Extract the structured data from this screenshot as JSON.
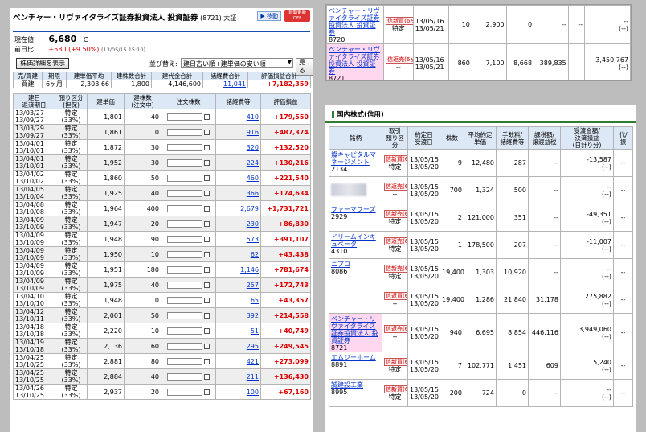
{
  "left": {
    "title": "ベンチャー・リヴァイタライズ証券投資法人 投資証券",
    "code": "(8721)",
    "market": "大証",
    "btn_move": "移動",
    "btn_auto": "自動更新 OFF",
    "price_label": "現在値",
    "price": "6,680",
    "price_mark": "C",
    "change_label": "前日比",
    "change": "+580 (+9.50%)",
    "change_time": "(13/05/15 15:10)",
    "btn_detail": "株価詳細を表示",
    "sort_label": "並び替え:",
    "sort_value": "建日古い順+建単価の安い順",
    "btn_view": "見る",
    "sum_headers": [
      "売/買建",
      "期限",
      "建単価平均",
      "建株数合計",
      "建代金合計",
      "諸経費合計",
      "評価損益合計"
    ],
    "sum_row": [
      "買建",
      "6ヶ月",
      "2,303.66",
      "1,800",
      "4,146,600",
      "11,041",
      "+7,182,359"
    ],
    "headers": [
      "建日\n返済期日",
      "預り区分\n(担保)",
      "建単価",
      "建株数\n(注文中)",
      "注文株数",
      "諸経費等",
      "評価損益"
    ],
    "rows": [
      {
        "date": "13/03/27",
        "due": "13/09/27",
        "kb": "特定",
        "tan": "(33%)",
        "price": "1,801",
        "qty": "40",
        "fee": "410",
        "pl": "+179,550"
      },
      {
        "date": "13/03/29",
        "due": "13/09/27",
        "kb": "特定",
        "tan": "(33%)",
        "price": "1,861",
        "qty": "110",
        "fee": "916",
        "pl": "+487,374"
      },
      {
        "date": "13/04/01",
        "due": "13/10/01",
        "kb": "特定",
        "tan": "(33%)",
        "price": "1,872",
        "qty": "30",
        "fee": "320",
        "pl": "+132,520"
      },
      {
        "date": "13/04/01",
        "due": "13/10/01",
        "kb": "特定",
        "tan": "(33%)",
        "price": "1,952",
        "qty": "30",
        "fee": "224",
        "pl": "+130,216"
      },
      {
        "date": "13/04/02",
        "due": "13/10/02",
        "kb": "特定",
        "tan": "(33%)",
        "price": "1,860",
        "qty": "50",
        "fee": "460",
        "pl": "+221,540"
      },
      {
        "date": "13/04/05",
        "due": "13/10/04",
        "kb": "特定",
        "tan": "(33%)",
        "price": "1,925",
        "qty": "40",
        "fee": "366",
        "pl": "+174,634"
      },
      {
        "date": "13/04/08",
        "due": "13/10/08",
        "kb": "特定",
        "tan": "(33%)",
        "price": "1,964",
        "qty": "400",
        "fee": "2,679",
        "pl": "+1,731,721"
      },
      {
        "date": "13/04/09",
        "due": "13/10/09",
        "kb": "特定",
        "tan": "(33%)",
        "price": "1,947",
        "qty": "20",
        "fee": "230",
        "pl": "+86,830"
      },
      {
        "date": "13/04/09",
        "due": "13/10/09",
        "kb": "特定",
        "tan": "(33%)",
        "price": "1,948",
        "qty": "90",
        "fee": "573",
        "pl": "+391,107"
      },
      {
        "date": "13/04/09",
        "due": "13/10/09",
        "kb": "特定",
        "tan": "(33%)",
        "price": "1,950",
        "qty": "10",
        "fee": "62",
        "pl": "+43,438"
      },
      {
        "date": "13/04/09",
        "due": "13/10/09",
        "kb": "特定",
        "tan": "(33%)",
        "price": "1,951",
        "qty": "180",
        "fee": "1,146",
        "pl": "+781,674"
      },
      {
        "date": "13/04/09",
        "due": "13/10/09",
        "kb": "特定",
        "tan": "(33%)",
        "price": "1,975",
        "qty": "40",
        "fee": "257",
        "pl": "+172,743"
      },
      {
        "date": "13/04/10",
        "due": "13/10/10",
        "kb": "特定",
        "tan": "(33%)",
        "price": "1,948",
        "qty": "10",
        "fee": "65",
        "pl": "+43,357"
      },
      {
        "date": "13/04/12",
        "due": "13/10/11",
        "kb": "特定",
        "tan": "(33%)",
        "price": "2,001",
        "qty": "50",
        "fee": "392",
        "pl": "+214,558"
      },
      {
        "date": "13/04/18",
        "due": "13/10/18",
        "kb": "特定",
        "tan": "(33%)",
        "price": "2,220",
        "qty": "10",
        "fee": "51",
        "pl": "+40,749"
      },
      {
        "date": "13/04/19",
        "due": "13/10/18",
        "kb": "特定",
        "tan": "(33%)",
        "price": "2,136",
        "qty": "60",
        "fee": "295",
        "pl": "+249,545"
      },
      {
        "date": "13/04/25",
        "due": "13/10/25",
        "kb": "特定",
        "tan": "(33%)",
        "price": "2,881",
        "qty": "80",
        "fee": "421",
        "pl": "+273,099"
      },
      {
        "date": "13/04/25",
        "due": "13/10/25",
        "kb": "特定",
        "tan": "(33%)",
        "price": "2,884",
        "qty": "40",
        "fee": "211",
        "pl": "+136,430"
      },
      {
        "date": "13/04/26",
        "due": "13/10/25",
        "kb": "特定",
        "tan": "(33%)",
        "price": "2,937",
        "qty": "20",
        "fee": "100",
        "pl": "+67,160"
      }
    ]
  },
  "topright": {
    "rows": [
      {
        "name": "ベンチャー・リヴァイタライズ証券投資法人 投資証券",
        "code": "8720",
        "badge": "信新買(6ヶ月)",
        "kb": "特定",
        "d1": "13/05/16",
        "d2": "13/05/21",
        "qty": "10",
        "price": "2,900",
        "fee": "0",
        "v1": "--",
        "v2": "--",
        "pl": "--",
        "pl2": "(--)"
      },
      {
        "name": "ベンチャー・リヴァイタライズ証券投資法人 投資証券",
        "code": "8721",
        "badge": "信返売(6ヶ月)",
        "kb": "--",
        "d1": "13/05/16",
        "d2": "13/05/21",
        "qty": "860",
        "price": "7,100",
        "fee": "8,668",
        "v1": "389,835",
        "v2": "",
        "pl": "3,450,767",
        "pl2": "(--)"
      }
    ]
  },
  "bottomright": {
    "title": "国内株式(信用)",
    "headers": [
      "銘柄",
      "取引\n預り区分",
      "約定日\n受渡日",
      "株数",
      "平均約定\n単価",
      "手数料/\n諸経費等",
      "課税額/\n譲渡益税",
      "受渡金額/\n決済損益\n(日計り分)",
      "代/\n振"
    ],
    "rows": [
      {
        "name": "燦キャピタルマネージメント",
        "code": "2134",
        "badge": "信新買(6ヶ月)",
        "kb": "特定",
        "d1": "13/05/15",
        "d2": "13/05/20",
        "qty": "9",
        "price": "12,480",
        "fee": "287",
        "tax": "--",
        "amt": "-13,587",
        "amt2": "(--)",
        "x": "--"
      },
      {
        "name": "",
        "code": "",
        "badge": "信返売(6ヶ月)",
        "kb": "--",
        "d1": "13/05/15",
        "d2": "13/05/20",
        "qty": "700",
        "price": "1,324",
        "fee": "500",
        "tax": "--",
        "amt": "--",
        "amt2": "(--)",
        "x": "--"
      },
      {
        "name": "ファーマフーズ",
        "code": "2929",
        "badge": "信新売(6ヶ月)",
        "kb": "特定",
        "d1": "13/05/15",
        "d2": "13/05/20",
        "qty": "2",
        "price": "121,000",
        "fee": "351",
        "tax": "--",
        "amt": "-49,351",
        "amt2": "(--)",
        "x": "--"
      },
      {
        "name": "ドリームインキュベータ",
        "code": "4310",
        "badge": "信返売(6ヶ月)",
        "kb": "特定",
        "d1": "13/05/15",
        "d2": "13/05/20",
        "qty": "1",
        "price": "178,500",
        "fee": "207",
        "tax": "--",
        "amt": "-11,007",
        "amt2": "(--)",
        "x": "--"
      },
      {
        "name": "ニプロ",
        "code": "8086",
        "badge": "信新売(6ヶ月)",
        "kb": "特定",
        "d1": "13/05/15",
        "d2": "13/05/20",
        "qty": "19,400",
        "price": "1,303",
        "fee": "10,920",
        "tax": "--",
        "amt": "--",
        "amt2": "(--)",
        "x": "--"
      },
      {
        "name": "",
        "code": "",
        "badge": "信返買(6ヶ月)",
        "kb": "--",
        "d1": "13/05/15",
        "d2": "13/05/20",
        "qty": "19,400",
        "price": "1,286",
        "fee": "21,840",
        "tax": "31,178",
        "amt": "275,882",
        "amt2": "(--)",
        "x": "--"
      },
      {
        "name": "ベンチャー・リヴァイタライズ証券投資法人 投資証券",
        "code": "8721",
        "badge": "信返売(6ヶ月)",
        "kb": "--",
        "d1": "13/05/15",
        "d2": "13/05/20",
        "qty": "940",
        "price": "6,695",
        "fee": "8,854",
        "tax": "446,116",
        "amt": "3,949,060",
        "amt2": "(--)",
        "x": "--"
      },
      {
        "name": "エムジーホーム",
        "code": "8891",
        "badge": "信新買(6ヶ月)",
        "kb": "特定",
        "d1": "13/05/15",
        "d2": "13/05/20",
        "qty": "7",
        "price": "102,771",
        "fee": "1,451",
        "tax": "609",
        "amt": "5,240",
        "amt2": "(--)",
        "x": "--"
      },
      {
        "name": "誠建設工業",
        "code": "8995",
        "badge": "信新買(6ヶ月)",
        "kb": "特定",
        "d1": "13/05/15",
        "d2": "13/05/20",
        "qty": "200",
        "price": "724",
        "fee": "0",
        "tax": "--",
        "amt": "--",
        "amt2": "(--)",
        "x": "--"
      }
    ]
  }
}
